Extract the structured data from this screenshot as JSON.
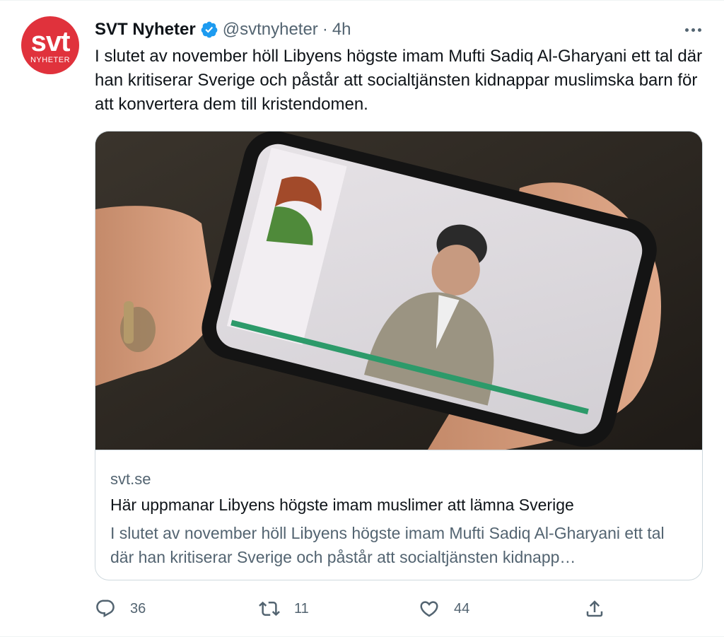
{
  "account": {
    "avatar_text": "svt",
    "avatar_subtext": "NYHETER",
    "name": "SVT Nyheter",
    "handle": "@svtnyheter",
    "separator": "·",
    "time": "4h",
    "brand_color": "#e0323c",
    "verified_color": "#1d9bf0"
  },
  "tweet": {
    "text": "I slutet av november höll Libyens högste imam Mufti Sadiq Al-Gharyani ett tal där han kritiserar Sverige och påstår att socialtjänsten kidnappar muslimska barn för att konvertera dem till kristendomen."
  },
  "card": {
    "domain": "svt.se",
    "title": "Här uppmanar Libyens högste imam muslimer att lämna Sverige",
    "description": "I slutet av november höll Libyens högste imam Mufti Sadiq Al-Gharyani ett tal där han kritiserar Sverige och påstår att socialtjänsten kidnapp…"
  },
  "actions": {
    "replies": "36",
    "retweets": "11",
    "likes": "44"
  },
  "icons": [
    "verified-badge-icon",
    "more-icon",
    "reply-icon",
    "retweet-icon",
    "like-icon",
    "share-icon"
  ]
}
